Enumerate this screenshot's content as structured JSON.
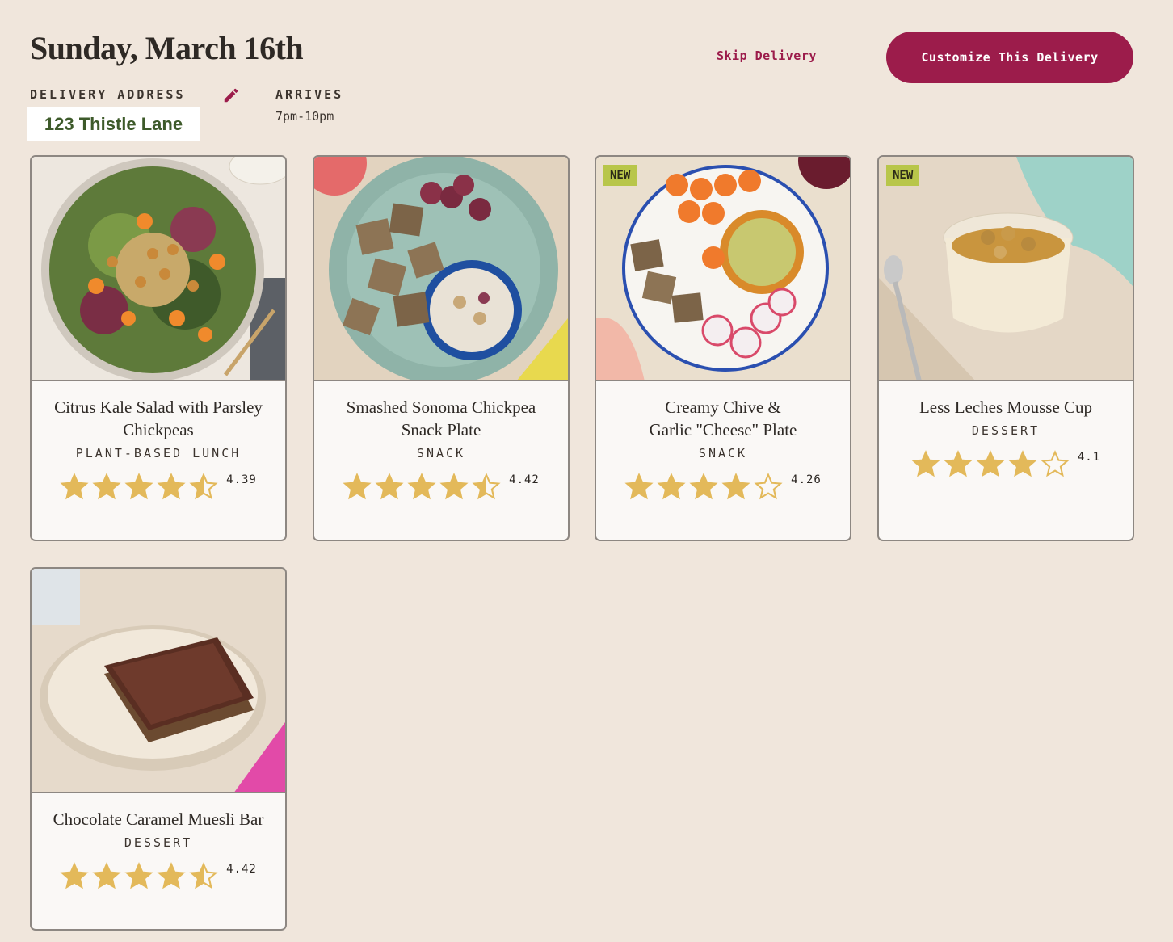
{
  "header": {
    "date": "Sunday, March 16th",
    "address_label": "DELIVERY ADDRESS",
    "address": "123 Thistle Lane",
    "arrives_label": "ARRIVES",
    "arrives_time": "7pm-10pm",
    "skip_label": "Skip Delivery",
    "customize_label": "Customize This Delivery"
  },
  "colors": {
    "accent": "#9c1c4b",
    "star": "#e3b95a",
    "badge": "#b8c64a",
    "background": "#f0e6dc"
  },
  "items": [
    {
      "title": "Citrus Kale Salad with Parsley Chickpeas",
      "category": "PLANT-BASED LUNCH",
      "rating": "4.39",
      "stars": 4.39,
      "badge": "",
      "image": "salad-photo"
    },
    {
      "title": "Smashed Sonoma Chickpea Snack Plate",
      "category": "SNACK",
      "rating": "4.42",
      "stars": 4.42,
      "badge": "",
      "image": "snack-plate-photo"
    },
    {
      "title": "Creamy Chive & Garlic \"Cheese\" Plate",
      "category": "SNACK",
      "rating": "4.26",
      "stars": 4.26,
      "badge": "NEW",
      "image": "cheese-plate-photo"
    },
    {
      "title": "Less Leches Mousse Cup",
      "category": "DESSERT",
      "rating": "4.1",
      "stars": 4.1,
      "badge": "NEW",
      "image": "mousse-photo"
    },
    {
      "title": "Chocolate Caramel Muesli Bar",
      "category": "DESSERT",
      "rating": "4.42",
      "stars": 4.42,
      "badge": "",
      "image": "muesli-bar-photo"
    }
  ]
}
